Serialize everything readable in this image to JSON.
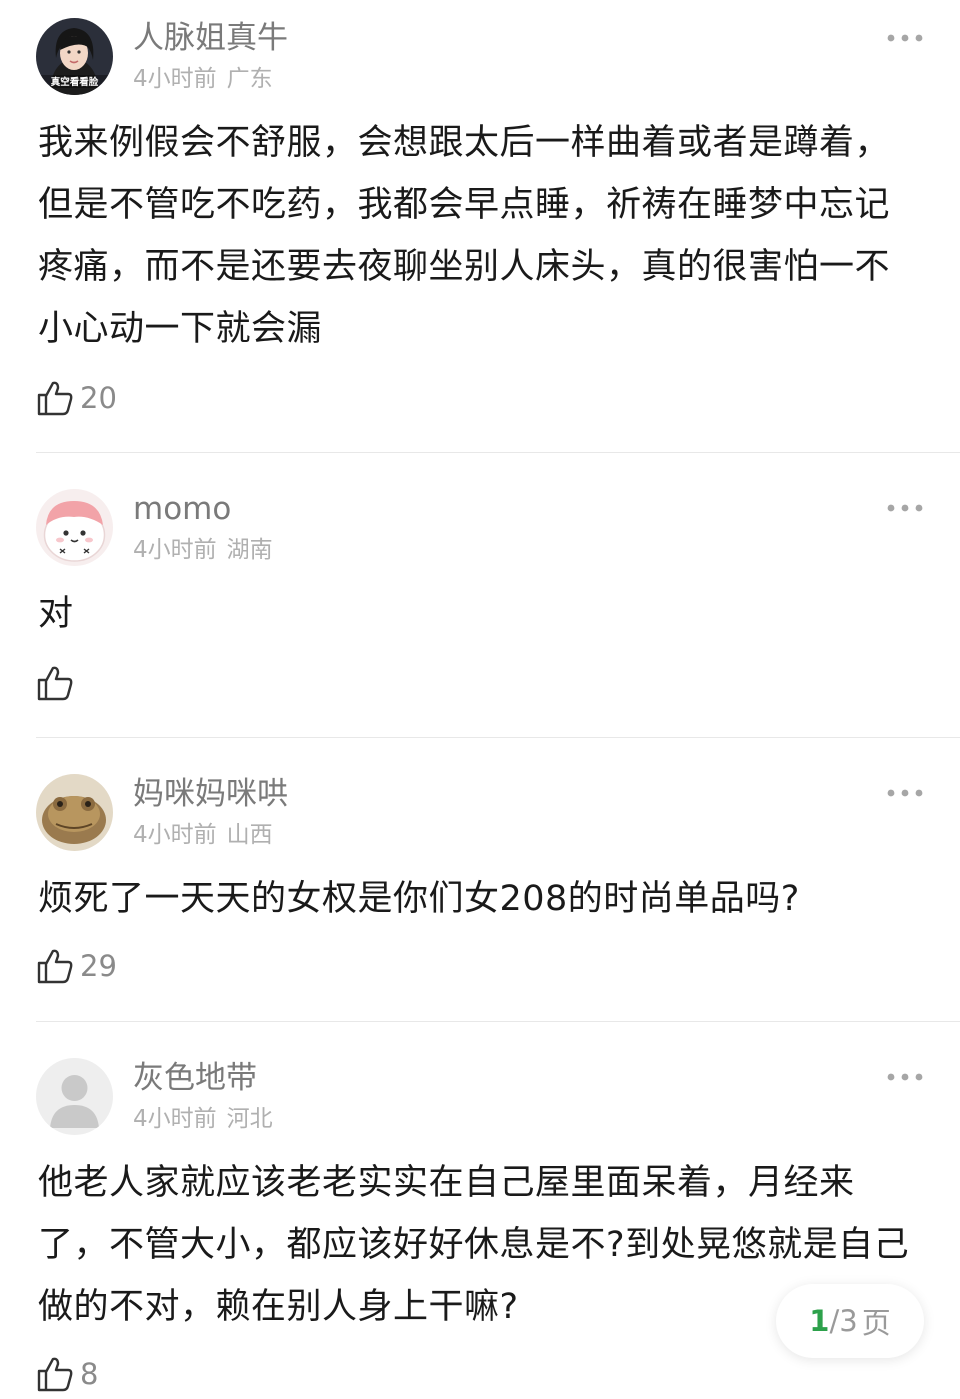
{
  "comments": [
    {
      "username": "人脉姐真牛",
      "time": "4小时前",
      "location": "广东",
      "text": "我来例假会不舒服，会想跟太后一样曲着或者是蹲着，但是不管吃不吃药，我都会早点睡，祈祷在睡梦中忘记疼痛，而不是还要去夜聊坐别人床头，真的很害怕一不小心动一下就会漏",
      "likes": "20",
      "avatar_icon": "woman-portrait-avatar",
      "avatar_caption": "真空看看脸"
    },
    {
      "username": "momo",
      "time": "4小时前",
      "location": "湖南",
      "text": "对",
      "likes": "",
      "avatar_icon": "pink-cartoon-blob-avatar"
    },
    {
      "username": "妈咪妈咪哄",
      "time": "4小时前",
      "location": "山西",
      "text": "烦死了一天天的女权是你们女208的时尚单品吗?",
      "likes": "29",
      "avatar_icon": "frog-photo-avatar"
    },
    {
      "username": "灰色地带",
      "time": "4小时前",
      "location": "河北",
      "text": "他老人家就应该老老实实在自己屋里面呆着，月经来了，不管大小，都应该好好休息是不?到处晃悠就是自己做的不对，赖在别人身上干嘛?",
      "likes": "8",
      "avatar_icon": "default-user-avatar"
    }
  ],
  "pager": {
    "current": "1",
    "separator": "/",
    "total": "3",
    "unit": "页"
  },
  "colors": {
    "accent_green": "#2da14b",
    "username_gray": "#7a7a7a",
    "meta_gray": "#b0b0b0",
    "divider": "#e8e8e8"
  }
}
